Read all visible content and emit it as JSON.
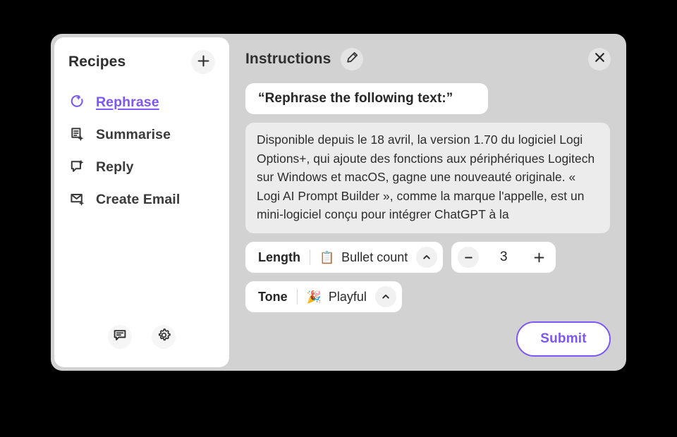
{
  "window": {
    "background_color": "#d2d2d2",
    "accent_color": "#7d56f4"
  },
  "sidebar": {
    "title": "Recipes",
    "add_icon": "plus-icon",
    "items": [
      {
        "label": "Rephrase",
        "icon": "rephrase-sparkle-icon",
        "active": true
      },
      {
        "label": "Summarise",
        "icon": "document-sparkle-icon",
        "active": false
      },
      {
        "label": "Reply",
        "icon": "chat-bubble-sparkle-icon",
        "active": false
      },
      {
        "label": "Create Email",
        "icon": "envelope-sparkle-icon",
        "active": false
      }
    ],
    "footer": [
      {
        "icon": "feedback-icon"
      },
      {
        "icon": "gear-icon"
      }
    ]
  },
  "main": {
    "title": "Instructions",
    "edit_icon": "pencil-icon",
    "close_icon": "close-icon",
    "prompt": {
      "value": "“Rephrase the following text:”",
      "placeholder": "Enter instructions"
    },
    "body_text": "Disponible depuis le 18 avril, la version 1.70 du logiciel Logi Options+, qui ajoute des fonctions aux périphériques Logitech sur Windows et macOS, gagne une nouveauté originale. « Logi AI Prompt Builder », comme la marque l'appelle, est un mini-logiciel conçu pour intégrer ChatGPT à la",
    "length_control": {
      "label": "Length",
      "emoji": "📋",
      "emoji_name": "clipboard-emoji",
      "value": "Bullet count",
      "chevron_icon": "chevron-up-icon"
    },
    "stepper": {
      "minus_icon": "minus-icon",
      "value": "3",
      "plus_icon": "plus-icon"
    },
    "tone_control": {
      "label": "Tone",
      "emoji": "🎉",
      "emoji_name": "party-popper-emoji",
      "value": "Playful",
      "chevron_icon": "chevron-up-icon"
    },
    "submit_label": "Submit"
  }
}
